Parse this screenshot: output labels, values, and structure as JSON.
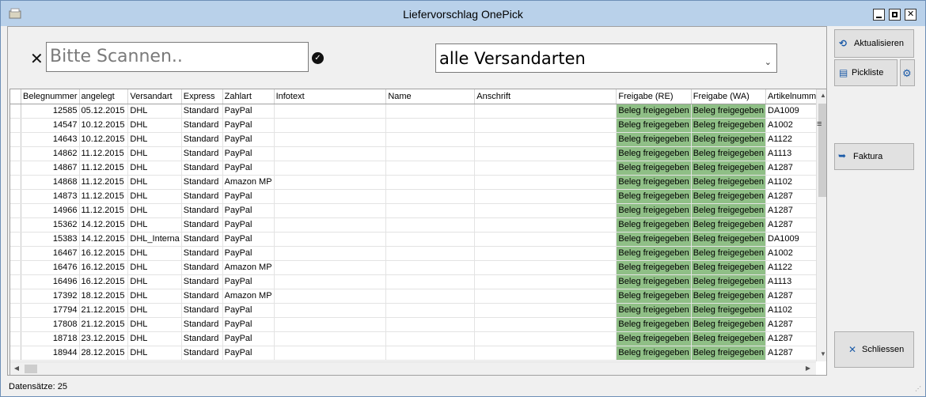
{
  "window": {
    "title": "Liefervorschlag OnePick"
  },
  "scan": {
    "placeholder": "Bitte Scannen.."
  },
  "filter": {
    "selected": "alle Versandarten"
  },
  "buttons": {
    "aktualisieren": "Aktualisieren",
    "pickliste": "Pickliste",
    "faktura": "Faktura",
    "schliessen": "Schliessen"
  },
  "table": {
    "columns": [
      "Belegnummer",
      "angelegt",
      "Versandart",
      "Express",
      "Zahlart",
      "Infotext",
      "Name",
      "Anschrift",
      "Freigabe (RE)",
      "Freigabe (WA)",
      "Artikelnummer"
    ],
    "rows": [
      [
        "12585",
        "05.12.2015",
        "DHL",
        "Standard",
        "PayPal",
        "",
        "",
        "",
        "Beleg freigegeben",
        "Beleg freigegeben",
        "DA1009"
      ],
      [
        "14547",
        "10.12.2015",
        "DHL",
        "Standard",
        "PayPal",
        "",
        "",
        "",
        "Beleg freigegeben",
        "Beleg freigegeben",
        "A1002"
      ],
      [
        "14643",
        "10.12.2015",
        "DHL",
        "Standard",
        "PayPal",
        "",
        "",
        "",
        "Beleg freigegeben",
        "Beleg freigegeben",
        "A1122"
      ],
      [
        "14862",
        "11.12.2015",
        "DHL",
        "Standard",
        "PayPal",
        "",
        "",
        "",
        "Beleg freigegeben",
        "Beleg freigegeben",
        "A1113"
      ],
      [
        "14867",
        "11.12.2015",
        "DHL",
        "Standard",
        "PayPal",
        "",
        "",
        "",
        "Beleg freigegeben",
        "Beleg freigegeben",
        "A1287"
      ],
      [
        "14868",
        "11.12.2015",
        "DHL",
        "Standard",
        "Amazon MP",
        "",
        "",
        "",
        "Beleg freigegeben",
        "Beleg freigegeben",
        "A1102"
      ],
      [
        "14873",
        "11.12.2015",
        "DHL",
        "Standard",
        "PayPal",
        "",
        "",
        "",
        "Beleg freigegeben",
        "Beleg freigegeben",
        "A1287"
      ],
      [
        "14966",
        "11.12.2015",
        "DHL",
        "Standard",
        "PayPal",
        "",
        "",
        "",
        "Beleg freigegeben",
        "Beleg freigegeben",
        "A1287"
      ],
      [
        "15362",
        "14.12.2015",
        "DHL",
        "Standard",
        "PayPal",
        "",
        "",
        "",
        "Beleg freigegeben",
        "Beleg freigegeben",
        "A1287"
      ],
      [
        "15383",
        "14.12.2015",
        "DHL_Interna",
        "Standard",
        "PayPal",
        "",
        "",
        "",
        "Beleg freigegeben",
        "Beleg freigegeben",
        "DA1009"
      ],
      [
        "16467",
        "16.12.2015",
        "DHL",
        "Standard",
        "PayPal",
        "",
        "",
        "",
        "Beleg freigegeben",
        "Beleg freigegeben",
        "A1002"
      ],
      [
        "16476",
        "16.12.2015",
        "DHL",
        "Standard",
        "Amazon MP",
        "",
        "",
        "",
        "Beleg freigegeben",
        "Beleg freigegeben",
        "A1122"
      ],
      [
        "16496",
        "16.12.2015",
        "DHL",
        "Standard",
        "PayPal",
        "",
        "",
        "",
        "Beleg freigegeben",
        "Beleg freigegeben",
        "A1113"
      ],
      [
        "17392",
        "18.12.2015",
        "DHL",
        "Standard",
        "Amazon MP",
        "",
        "",
        "",
        "Beleg freigegeben",
        "Beleg freigegeben",
        "A1287"
      ],
      [
        "17794",
        "21.12.2015",
        "DHL",
        "Standard",
        "PayPal",
        "",
        "",
        "",
        "Beleg freigegeben",
        "Beleg freigegeben",
        "A1102"
      ],
      [
        "17808",
        "21.12.2015",
        "DHL",
        "Standard",
        "PayPal",
        "",
        "",
        "",
        "Beleg freigegeben",
        "Beleg freigegeben",
        "A1287"
      ],
      [
        "18718",
        "23.12.2015",
        "DHL",
        "Standard",
        "PayPal",
        "",
        "",
        "",
        "Beleg freigegeben",
        "Beleg freigegeben",
        "A1287"
      ],
      [
        "18944",
        "28.12.2015",
        "DHL",
        "Standard",
        "PayPal",
        "",
        "",
        "",
        "Beleg freigegeben",
        "Beleg freigegeben",
        "A1287"
      ]
    ]
  },
  "status": {
    "text": "Datensätze: 25"
  },
  "colors": {
    "released": "#8fbf86",
    "titlebar": "#b9d1ea",
    "accent": "#1c5ba8"
  },
  "icons": [
    "app-icon",
    "clear-icon",
    "confirm-icon",
    "refresh-icon",
    "clipboard-icon",
    "gear-icon",
    "arrow-right-icon",
    "close-icon"
  ]
}
